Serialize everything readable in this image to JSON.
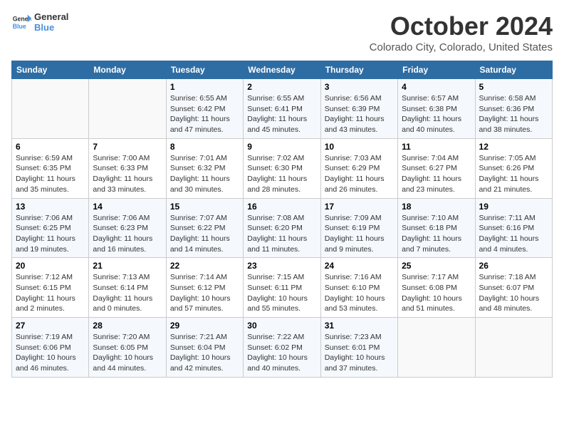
{
  "header": {
    "logo_line1": "General",
    "logo_line2": "Blue",
    "month": "October 2024",
    "location": "Colorado City, Colorado, United States"
  },
  "weekdays": [
    "Sunday",
    "Monday",
    "Tuesday",
    "Wednesday",
    "Thursday",
    "Friday",
    "Saturday"
  ],
  "weeks": [
    [
      {
        "day": "",
        "info": ""
      },
      {
        "day": "",
        "info": ""
      },
      {
        "day": "1",
        "info": "Sunrise: 6:55 AM\nSunset: 6:42 PM\nDaylight: 11 hours and 47 minutes."
      },
      {
        "day": "2",
        "info": "Sunrise: 6:55 AM\nSunset: 6:41 PM\nDaylight: 11 hours and 45 minutes."
      },
      {
        "day": "3",
        "info": "Sunrise: 6:56 AM\nSunset: 6:39 PM\nDaylight: 11 hours and 43 minutes."
      },
      {
        "day": "4",
        "info": "Sunrise: 6:57 AM\nSunset: 6:38 PM\nDaylight: 11 hours and 40 minutes."
      },
      {
        "day": "5",
        "info": "Sunrise: 6:58 AM\nSunset: 6:36 PM\nDaylight: 11 hours and 38 minutes."
      }
    ],
    [
      {
        "day": "6",
        "info": "Sunrise: 6:59 AM\nSunset: 6:35 PM\nDaylight: 11 hours and 35 minutes."
      },
      {
        "day": "7",
        "info": "Sunrise: 7:00 AM\nSunset: 6:33 PM\nDaylight: 11 hours and 33 minutes."
      },
      {
        "day": "8",
        "info": "Sunrise: 7:01 AM\nSunset: 6:32 PM\nDaylight: 11 hours and 30 minutes."
      },
      {
        "day": "9",
        "info": "Sunrise: 7:02 AM\nSunset: 6:30 PM\nDaylight: 11 hours and 28 minutes."
      },
      {
        "day": "10",
        "info": "Sunrise: 7:03 AM\nSunset: 6:29 PM\nDaylight: 11 hours and 26 minutes."
      },
      {
        "day": "11",
        "info": "Sunrise: 7:04 AM\nSunset: 6:27 PM\nDaylight: 11 hours and 23 minutes."
      },
      {
        "day": "12",
        "info": "Sunrise: 7:05 AM\nSunset: 6:26 PM\nDaylight: 11 hours and 21 minutes."
      }
    ],
    [
      {
        "day": "13",
        "info": "Sunrise: 7:06 AM\nSunset: 6:25 PM\nDaylight: 11 hours and 19 minutes."
      },
      {
        "day": "14",
        "info": "Sunrise: 7:06 AM\nSunset: 6:23 PM\nDaylight: 11 hours and 16 minutes."
      },
      {
        "day": "15",
        "info": "Sunrise: 7:07 AM\nSunset: 6:22 PM\nDaylight: 11 hours and 14 minutes."
      },
      {
        "day": "16",
        "info": "Sunrise: 7:08 AM\nSunset: 6:20 PM\nDaylight: 11 hours and 11 minutes."
      },
      {
        "day": "17",
        "info": "Sunrise: 7:09 AM\nSunset: 6:19 PM\nDaylight: 11 hours and 9 minutes."
      },
      {
        "day": "18",
        "info": "Sunrise: 7:10 AM\nSunset: 6:18 PM\nDaylight: 11 hours and 7 minutes."
      },
      {
        "day": "19",
        "info": "Sunrise: 7:11 AM\nSunset: 6:16 PM\nDaylight: 11 hours and 4 minutes."
      }
    ],
    [
      {
        "day": "20",
        "info": "Sunrise: 7:12 AM\nSunset: 6:15 PM\nDaylight: 11 hours and 2 minutes."
      },
      {
        "day": "21",
        "info": "Sunrise: 7:13 AM\nSunset: 6:14 PM\nDaylight: 11 hours and 0 minutes."
      },
      {
        "day": "22",
        "info": "Sunrise: 7:14 AM\nSunset: 6:12 PM\nDaylight: 10 hours and 57 minutes."
      },
      {
        "day": "23",
        "info": "Sunrise: 7:15 AM\nSunset: 6:11 PM\nDaylight: 10 hours and 55 minutes."
      },
      {
        "day": "24",
        "info": "Sunrise: 7:16 AM\nSunset: 6:10 PM\nDaylight: 10 hours and 53 minutes."
      },
      {
        "day": "25",
        "info": "Sunrise: 7:17 AM\nSunset: 6:08 PM\nDaylight: 10 hours and 51 minutes."
      },
      {
        "day": "26",
        "info": "Sunrise: 7:18 AM\nSunset: 6:07 PM\nDaylight: 10 hours and 48 minutes."
      }
    ],
    [
      {
        "day": "27",
        "info": "Sunrise: 7:19 AM\nSunset: 6:06 PM\nDaylight: 10 hours and 46 minutes."
      },
      {
        "day": "28",
        "info": "Sunrise: 7:20 AM\nSunset: 6:05 PM\nDaylight: 10 hours and 44 minutes."
      },
      {
        "day": "29",
        "info": "Sunrise: 7:21 AM\nSunset: 6:04 PM\nDaylight: 10 hours and 42 minutes."
      },
      {
        "day": "30",
        "info": "Sunrise: 7:22 AM\nSunset: 6:02 PM\nDaylight: 10 hours and 40 minutes."
      },
      {
        "day": "31",
        "info": "Sunrise: 7:23 AM\nSunset: 6:01 PM\nDaylight: 10 hours and 37 minutes."
      },
      {
        "day": "",
        "info": ""
      },
      {
        "day": "",
        "info": ""
      }
    ]
  ]
}
